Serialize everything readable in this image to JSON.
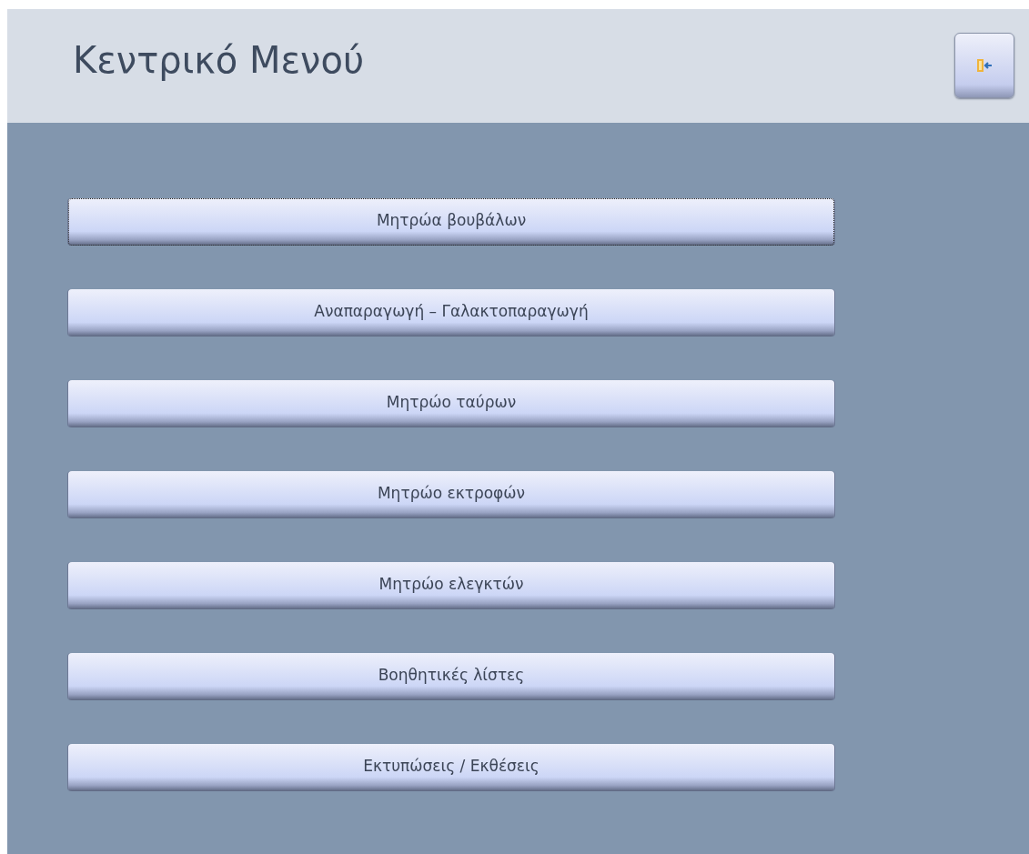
{
  "header": {
    "title": "Κεντρικό Μενού"
  },
  "menu_buttons": [
    {
      "label": "Μητρώα βουβάλων",
      "focused": true
    },
    {
      "label": "Αναπαραγωγή – Γαλακτοπαραγωγή",
      "focused": false
    },
    {
      "label": "Μητρώο ταύρων",
      "focused": false
    },
    {
      "label": "Μητρώο εκτροφών",
      "focused": false
    },
    {
      "label": "Μητρώο ελεγκτών",
      "focused": false
    },
    {
      "label": "Βοηθητικές λίστες",
      "focused": false
    },
    {
      "label": "Εκτυπώσεις / Εκθέσεις",
      "focused": false
    }
  ]
}
